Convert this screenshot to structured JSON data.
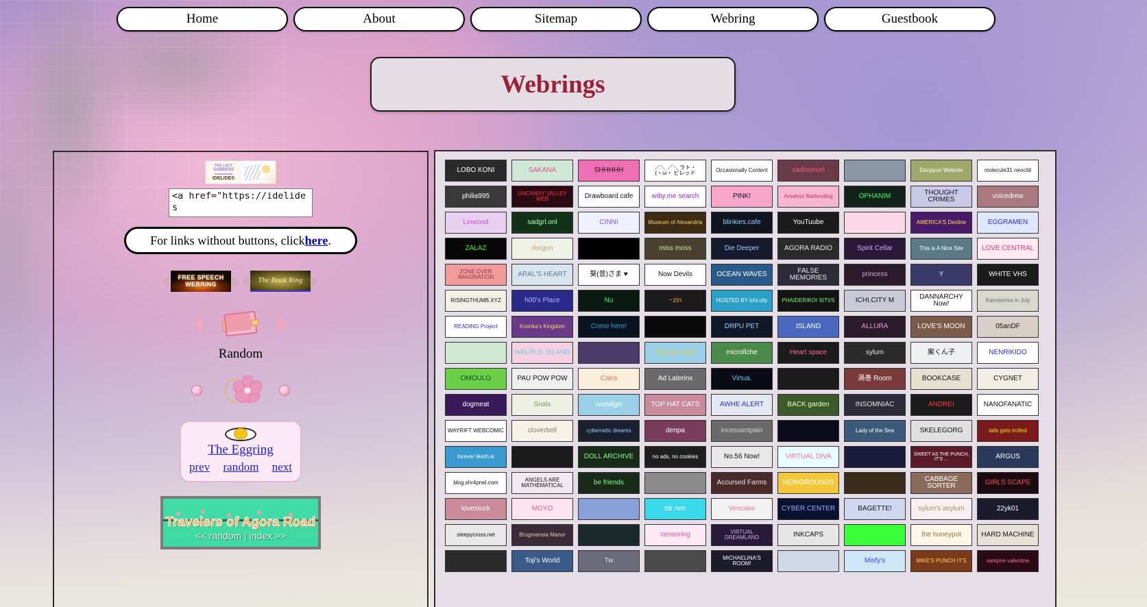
{
  "nav": {
    "items": [
      {
        "label": "Home"
      },
      {
        "label": "About"
      },
      {
        "label": "Sitemap"
      },
      {
        "label": "Webring"
      },
      {
        "label": "Guestbook"
      }
    ]
  },
  "header": {
    "title": "Webrings"
  },
  "sidebar": {
    "idelides_banner": {
      "line1": "THE LAZY",
      "line2": "GODDESS",
      "line3": "IDELIDES"
    },
    "code_box": {
      "value": "<a href=\"https://idelides",
      "placeholder": ""
    },
    "links_note": {
      "prefix": "For links without buttons, click ",
      "link": "here",
      "suffix": "."
    },
    "ring_banners": [
      {
        "label": "FREE SPEECH\nWEBRING",
        "name": "free-speech-webring"
      },
      {
        "label": "The Book Ring",
        "name": "the-book-ring"
      }
    ],
    "random_widget": {
      "label": "Random"
    },
    "eggring": {
      "title": "The Eggring",
      "prev": "prev",
      "random": "random",
      "next": "next"
    },
    "agora": {
      "title": "Travelers of Agora Road",
      "subtitle": "<< random | index >>"
    }
  },
  "colors": {
    "accent_red": "#9d1f38",
    "link_blue": "#2020d0",
    "panel_bg": "#e6dee6",
    "nav_bg": "#ffffff",
    "agora_green": "#41dca8"
  },
  "button_grid": {
    "columns": 9,
    "buttons": [
      {
        "label": "LOBO KONI",
        "fg": "#ffffff",
        "bg": "#2b2b2b",
        "border": true
      },
      {
        "label": "SAKANA",
        "fg": "#e0508f",
        "bg": "#cfe8d8",
        "border": true
      },
      {
        "label": "SHHHHH",
        "fg": "#111111",
        "bg": "#ef6fb4",
        "border": true
      },
      {
        "label": "／＼ ／＼ ラト・\n(・ω・ ビレッド",
        "fg": "#111111",
        "bg": "#ffffff",
        "border": true
      },
      {
        "label": "Occasionally Content",
        "fg": "#111111",
        "bg": "#ffffff",
        "border": true
      },
      {
        "label": "cadnomori",
        "fg": "#ff5a7a",
        "bg": "#6b3a48",
        "border": true
      },
      {
        "label": "",
        "fg": "#ffffff",
        "bg": "#8a97a6",
        "border": true
      },
      {
        "label": "Danppun Website",
        "fg": "#ffffff",
        "bg": "#9ea86a",
        "border": true
      },
      {
        "label": "molecule31 neocitil",
        "fg": "#111111",
        "bg": "#ffffff",
        "border": true
      },
      {
        "label": "philia995",
        "fg": "#ffffff",
        "bg": "#3a3a3a",
        "border": true
      },
      {
        "label": "UNCANNY VALLEY WEB",
        "fg": "#ff3344",
        "bg": "#2b0a14",
        "border": true
      },
      {
        "label": "Drawboard.cafe",
        "fg": "#111111",
        "bg": "#ffffff",
        "border": true
      },
      {
        "label": "wiby.me search",
        "fg": "#8a1fd0",
        "bg": "#ffffff",
        "border": true
      },
      {
        "label": "PINK!",
        "fg": "#111111",
        "bg": "#f9a6cb",
        "border": true
      },
      {
        "label": "Amateur Bartending",
        "fg": "#c42b6c",
        "bg": "#f7b7cf",
        "border": true
      },
      {
        "label": "OPHANIM",
        "fg": "#33ff66",
        "bg": "#12221a",
        "border": true
      },
      {
        "label": "THOUGHT CRIMES",
        "fg": "#111111",
        "bg": "#c9c9e8",
        "border": true
      },
      {
        "label": "voicedrew",
        "fg": "#ffffff",
        "bg": "#a9797f",
        "border": true
      },
      {
        "label": "Linwood",
        "fg": "#c452d6",
        "bg": "#e8d0f0",
        "border": true
      },
      {
        "label": "sadgrl.onl",
        "fg": "#b0ffb0",
        "bg": "#123317",
        "border": true
      },
      {
        "label": "CINNI",
        "fg": "#7a5ad8",
        "bg": "#eef0ff",
        "border": true
      },
      {
        "label": "Museum of Alexandria",
        "fg": "#ffd36a",
        "bg": "#3b2b12",
        "border": true
      },
      {
        "label": "blinkies.cafe",
        "fg": "#9ad0ff",
        "bg": "#10141f",
        "border": true
      },
      {
        "label": "YouTuube",
        "fg": "#ffffff",
        "bg": "#1b1b1b",
        "border": true
      },
      {
        "label": "",
        "fg": "#c9306a",
        "bg": "#fbd8e6",
        "border": true
      },
      {
        "label": "AMERICA'S Decline",
        "fg": "#ffe14a",
        "bg": "#4a1a6a",
        "border": true
      },
      {
        "label": "EGGRAMEN",
        "fg": "#2b2bd0",
        "bg": "#dfe7fb",
        "border": true
      },
      {
        "label": "ZALAZ",
        "fg": "#33ff33",
        "bg": "#070707",
        "border": true
      },
      {
        "label": "dorgon",
        "fg": "#c8a26a",
        "bg": "#eef1e6",
        "border": true
      },
      {
        "label": "",
        "fg": "#ffffff",
        "bg": "#000000",
        "border": true
      },
      {
        "label": "miss moss",
        "fg": "#bff0a0",
        "bg": "#4a4030",
        "border": true
      },
      {
        "label": "Die Deeper",
        "fg": "#9ad0ff",
        "bg": "#141a2b",
        "border": true
      },
      {
        "label": "AGORA RADIO",
        "fg": "#e8e8e8",
        "bg": "#2b2b2b",
        "border": true
      },
      {
        "label": "Spirit Cellar",
        "fg": "#d8a8ff",
        "bg": "#2a1838",
        "border": true
      },
      {
        "label": "This is A Nice Site",
        "fg": "#ffffff",
        "bg": "#5a7a8a",
        "border": true
      },
      {
        "label": "LOVE CENTRAL",
        "fg": "#e8366a",
        "bg": "#ffeaf2",
        "border": true
      },
      {
        "label": "ZONE OVER IMAGINATION",
        "fg": "#8a3a4a",
        "bg": "#f09a9a",
        "border": true
      },
      {
        "label": "ARAL'S HEART",
        "fg": "#5a7a9a",
        "bg": "#d8e4ee",
        "border": true
      },
      {
        "label": "葵(昔)さま ♥",
        "fg": "#111111",
        "bg": "#ffffff",
        "border": true
      },
      {
        "label": "Now Devils",
        "fg": "#111111",
        "bg": "#ffffff",
        "border": true
      },
      {
        "label": "OCEAN WAVES",
        "fg": "#ffffff",
        "bg": "#2a5a8a",
        "border": true
      },
      {
        "label": "FALSE MEMORIES",
        "fg": "#e8e8e8",
        "bg": "#2b2b3a",
        "border": true
      },
      {
        "label": "princess",
        "fg": "#d8a8d8",
        "bg": "#2a1a2a",
        "border": true
      },
      {
        "label": "Y",
        "fg": "#e8e8e8",
        "bg": "#3a3a6a",
        "border": true
      },
      {
        "label": "WHITE VHS",
        "fg": "#ffffff",
        "bg": "#1b1b1b",
        "border": true
      },
      {
        "label": "RISINGTHUMB.XYZ",
        "fg": "#111111",
        "bg": "#f2efe6",
        "border": true
      },
      {
        "label": "h00's Place",
        "fg": "#b0b8ff",
        "bg": "#2a2a8a",
        "border": true
      },
      {
        "label": "Nu",
        "fg": "#33ee88",
        "bg": "#0a1a10",
        "border": true
      },
      {
        "label": "~zin",
        "fg": "#ffa040",
        "bg": "#1b1b1b",
        "border": true
      },
      {
        "label": "HOSTED BY ichi.city",
        "fg": "#ffffff",
        "bg": "#2aa0c8",
        "border": true
      },
      {
        "label": "PHAIDERIKOI SITVS",
        "fg": "#7aff7a",
        "bg": "#141414",
        "border": true
      },
      {
        "label": "ICHI.CITY M",
        "fg": "#111111",
        "bg": "#c9c9d8",
        "border": true
      },
      {
        "label": "DANNARCHY Now!",
        "fg": "#111111",
        "bg": "#ffffff",
        "border": true
      },
      {
        "label": "Rainstorms in July",
        "fg": "#6a6a6a",
        "bg": "#d8d8cf",
        "border": true
      },
      {
        "label": "READING Project",
        "fg": "#2b2bd0",
        "bg": "#ffffff",
        "border": true
      },
      {
        "label": "Koshka's Kingdom",
        "fg": "#ffd36a",
        "bg": "#6a3a8a",
        "border": true
      },
      {
        "label": "Come here!",
        "fg": "#2a9ad8",
        "bg": "#0a1420",
        "border": true
      },
      {
        "label": "",
        "fg": "#ffffff",
        "bg": "#0a0a0a",
        "border": true
      },
      {
        "label": "DRPU PET",
        "fg": "#9ad0ff",
        "bg": "#101828",
        "border": true
      },
      {
        "label": "ISLAND",
        "fg": "#ffffff",
        "bg": "#4a6abf",
        "border": true
      },
      {
        "label": "ALLURA",
        "fg": "#e8a0d8",
        "bg": "#2a1a2a",
        "border": true
      },
      {
        "label": "LOVE'S MOON",
        "fg": "#ffffff",
        "bg": "#7a5a4a",
        "border": true
      },
      {
        "label": "05anDF",
        "fg": "#111111",
        "bg": "#d8d0c8",
        "border": true
      },
      {
        "label": "",
        "fg": "#111111",
        "bg": "#cfe8d0",
        "border": true
      },
      {
        "label": "WALRUS ISLAND",
        "fg": "#6ad0e8",
        "bg": "#f7cfe2",
        "border": true
      },
      {
        "label": "",
        "fg": "#e8e8e8",
        "bg": "#4a3a6a",
        "border": true
      },
      {
        "label": "halcyon days",
        "fg": "#e8c84a",
        "bg": "#9ad0e8",
        "border": true
      },
      {
        "label": "microfiche",
        "fg": "#ffffff",
        "bg": "#4a8a4a",
        "border": true
      },
      {
        "label": "Heart space",
        "fg": "#ff6a9a",
        "bg": "#1b1b1b",
        "border": true
      },
      {
        "label": "sylum",
        "fg": "#e8e8e8",
        "bg": "#2b2b2b",
        "border": true
      },
      {
        "label": "案くん子",
        "fg": "#111111",
        "bg": "#eef0f2",
        "border": true
      },
      {
        "label": "NENRIKIDO",
        "fg": "#2b2bd0",
        "bg": "#ffffff",
        "border": true
      },
      {
        "label": "OMOULO",
        "fg": "#1a4a1a",
        "bg": "#6ad04a",
        "border": true
      },
      {
        "label": "PAU POW POW",
        "fg": "#111111",
        "bg": "#eef0ee",
        "border": true
      },
      {
        "label": "Catra",
        "fg": "#e8704a",
        "bg": "#fbefdc",
        "border": true
      },
      {
        "label": "Ad Laterinx",
        "fg": "#ffffff",
        "bg": "#6a6a6a",
        "border": true
      },
      {
        "label": "Virtua.",
        "fg": "#6ad0ff",
        "bg": "#0a0a14",
        "border": true
      },
      {
        "label": "",
        "fg": "#e8e8e8",
        "bg": "#1b1b1b",
        "border": true
      },
      {
        "label": "渦巻 Room",
        "fg": "#ffffff",
        "bg": "#7a3a3a",
        "border": true
      },
      {
        "label": "BOOKCASE",
        "fg": "#111111",
        "bg": "#e6e0d0",
        "border": true
      },
      {
        "label": "CYGNET",
        "fg": "#111111",
        "bg": "#f2eee6",
        "border": true
      },
      {
        "label": "dogmeat",
        "fg": "#ffffff",
        "bg": "#3a1a5a",
        "border": true
      },
      {
        "label": "Snals",
        "fg": "#7a9a4a",
        "bg": "#eef0e4",
        "border": true
      },
      {
        "label": "nostalgic",
        "fg": "#ffffff",
        "bg": "#9ad0e8",
        "border": true
      },
      {
        "label": "TOP HAT CATS",
        "fg": "#ffffff",
        "bg": "#c98a9a",
        "border": true
      },
      {
        "label": "AWHE ALERT",
        "fg": "#2b2bd0",
        "bg": "#e4e8f2",
        "border": true
      },
      {
        "label": "BACK garden",
        "fg": "#e8ffcf",
        "bg": "#3a5a2a",
        "border": true
      },
      {
        "label": "INSOMNIAC",
        "fg": "#e8e8e8",
        "bg": "#2b2b3a",
        "border": true
      },
      {
        "label": "ANDREI",
        "fg": "#ff3a3a",
        "bg": "#1b1b1b",
        "border": true
      },
      {
        "label": "NANOFANATIC",
        "fg": "#111111",
        "bg": "#ffffff",
        "border": true
      },
      {
        "label": "WAYRIFT WEBCOMIC",
        "fg": "#111111",
        "bg": "#ffffff",
        "border": true
      },
      {
        "label": "cloverbell",
        "fg": "#8a7a5a",
        "bg": "#f7f2e8",
        "border": true
      },
      {
        "label": "cybernetic dreams",
        "fg": "#9ad0ff",
        "bg": "#1b2030",
        "border": true
      },
      {
        "label": "denpa",
        "fg": "#ffffff",
        "bg": "#7a3a5a",
        "border": true
      },
      {
        "label": "incessantpain",
        "fg": "#cfcfcf",
        "bg": "#6a6a6a",
        "border": true
      },
      {
        "label": "",
        "fg": "#6ad0ff",
        "bg": "#0a0a1a",
        "border": true
      },
      {
        "label": "Lady of the Sea",
        "fg": "#ffffff",
        "bg": "#3a5a7a",
        "border": true
      },
      {
        "label": "SKELEGORG",
        "fg": "#111111",
        "bg": "#e0e0e0",
        "border": true
      },
      {
        "label": "tails gets trolled",
        "fg": "#e8e800",
        "bg": "#7a1a1a",
        "border": true
      },
      {
        "label": "forever liketh.is",
        "fg": "#ffffff",
        "bg": "#3a9ad0",
        "border": true
      },
      {
        "label": "",
        "fg": "#ff6aa0",
        "bg": "#1b1b1b",
        "border": true
      },
      {
        "label": "DOLL ARCHIVE",
        "fg": "#8aff8a",
        "bg": "#1a2a1a",
        "border": true
      },
      {
        "label": "no ads, no cookies",
        "fg": "#ffffff",
        "bg": "#1f1f1f",
        "border": true
      },
      {
        "label": "No.56 Now!",
        "fg": "#111111",
        "bg": "#e8e8e8",
        "border": true
      },
      {
        "label": "VIRTUAL DIVA",
        "fg": "#ff6ab0",
        "bg": "#e8fbff",
        "border": true
      },
      {
        "label": "",
        "fg": "#ffffff",
        "bg": "#1a1a3a",
        "border": true
      },
      {
        "label": "SWEET AS THE PUNCH, IT'S ...",
        "fg": "#ffffff",
        "bg": "#5a1a2a",
        "border": true
      },
      {
        "label": "ARGUS",
        "fg": "#ffffff",
        "bg": "#2a3a5a",
        "border": true
      },
      {
        "label": "blog.shr4pnel.com",
        "fg": "#111111",
        "bg": "#ffffff",
        "border": true
      },
      {
        "label": "ANGELS ARE MATHEMATICAL",
        "fg": "#111111",
        "bg": "#f2e8f2",
        "border": true
      },
      {
        "label": "be friends",
        "fg": "#8aff8a",
        "bg": "#1a2a1a",
        "border": true
      },
      {
        "label": "",
        "fg": "#e8e8e8",
        "bg": "#8a8a8a",
        "border": true
      },
      {
        "label": "Accursed Farms",
        "fg": "#e8e8e8",
        "bg": "#4a2a2a",
        "border": true
      },
      {
        "label": "NEWGROUNDS",
        "fg": "#ffffff",
        "bg": "#f2c83a",
        "border": true
      },
      {
        "label": "",
        "fg": "#e8e8e8",
        "bg": "#3a2a1a",
        "border": true
      },
      {
        "label": "CABBAGE SORTER",
        "fg": "#ffffff",
        "bg": "#8a6a5a",
        "border": true
      },
      {
        "label": "GIRLS SCAPE",
        "fg": "#ff4a6a",
        "bg": "#1b0a10",
        "border": true
      },
      {
        "label": "lovestuck",
        "fg": "#ffffff",
        "bg": "#c98a9a",
        "border": true
      },
      {
        "label": "MOYO",
        "fg": "#e85a8a",
        "bg": "#fbe4ee",
        "border": true
      },
      {
        "label": "",
        "fg": "#ffffff",
        "bg": "#8aa0d8",
        "border": true
      },
      {
        "label": "tdr neo",
        "fg": "#ffffff",
        "bg": "#3ad8e8",
        "border": true
      },
      {
        "label": "Vencake",
        "fg": "#e8789a",
        "bg": "#f2f2f2",
        "border": true
      },
      {
        "label": "CYBER CENTER",
        "fg": "#9ab0ff",
        "bg": "#0a1030",
        "border": true
      },
      {
        "label": "BAGETTE!",
        "fg": "#111111",
        "bg": "#cfd8ee",
        "border": true
      },
      {
        "label": "sylum's asylum",
        "fg": "#8a9a5a",
        "bg": "#fbeef2",
        "border": true
      },
      {
        "label": "22yk01",
        "fg": "#ffffff",
        "bg": "#1b1b2b",
        "border": true
      },
      {
        "label": "sleepycross.net",
        "fg": "#111111",
        "bg": "#e8e8e8",
        "border": true
      },
      {
        "label": "Brugmansia Manor",
        "fg": "#e8cfa0",
        "bg": "#3a2a3a",
        "border": true
      },
      {
        "label": "",
        "fg": "#8aff8a",
        "bg": "#1a2a2a",
        "border": true
      },
      {
        "label": "censoring",
        "fg": "#e8509a",
        "bg": "#fbe8f2",
        "border": true
      },
      {
        "label": "VIRTUAL DREAMLAND",
        "fg": "#cfb0e8",
        "bg": "#2a1a3a",
        "border": true
      },
      {
        "label": "INKCAPS",
        "fg": "#111111",
        "bg": "#e6e6e6",
        "border": true
      },
      {
        "label": "",
        "fg": "#0a0a0a",
        "bg": "#3aff3a",
        "border": true
      },
      {
        "label": "the honeypot",
        "fg": "#8a7a3a",
        "bg": "#fbf6e8",
        "border": true
      },
      {
        "label": "HARD MACHINE",
        "fg": "#111111",
        "bg": "#e8e0d8",
        "border": true
      },
      {
        "label": "",
        "fg": "#e8e8e8",
        "bg": "#2b2b2b",
        "border": true
      },
      {
        "label": "Toji's World",
        "fg": "#ffffff",
        "bg": "#3a5a8a",
        "border": true
      },
      {
        "label": "Tw",
        "fg": "#e8e8e8",
        "bg": "#6a6a7a",
        "border": true
      },
      {
        "label": "",
        "fg": "#e8e8e8",
        "bg": "#4a4a4a",
        "border": true
      },
      {
        "label": "MICHAELINA'S ROOM!",
        "fg": "#ffffff",
        "bg": "#1b1b2b",
        "border": true
      },
      {
        "label": "",
        "fg": "#111111",
        "bg": "#cfd8e8",
        "border": true
      },
      {
        "label": "Misfy's",
        "fg": "#3a3aff",
        "bg": "#cfe8f7",
        "border": true
      },
      {
        "label": "MIKE'S PUNCH IT'S",
        "fg": "#ffd36a",
        "bg": "#7a3a1a",
        "border": true
      },
      {
        "label": "vampire valentine",
        "fg": "#ff6a9a",
        "bg": "#2a0a14",
        "border": true
      }
    ]
  }
}
